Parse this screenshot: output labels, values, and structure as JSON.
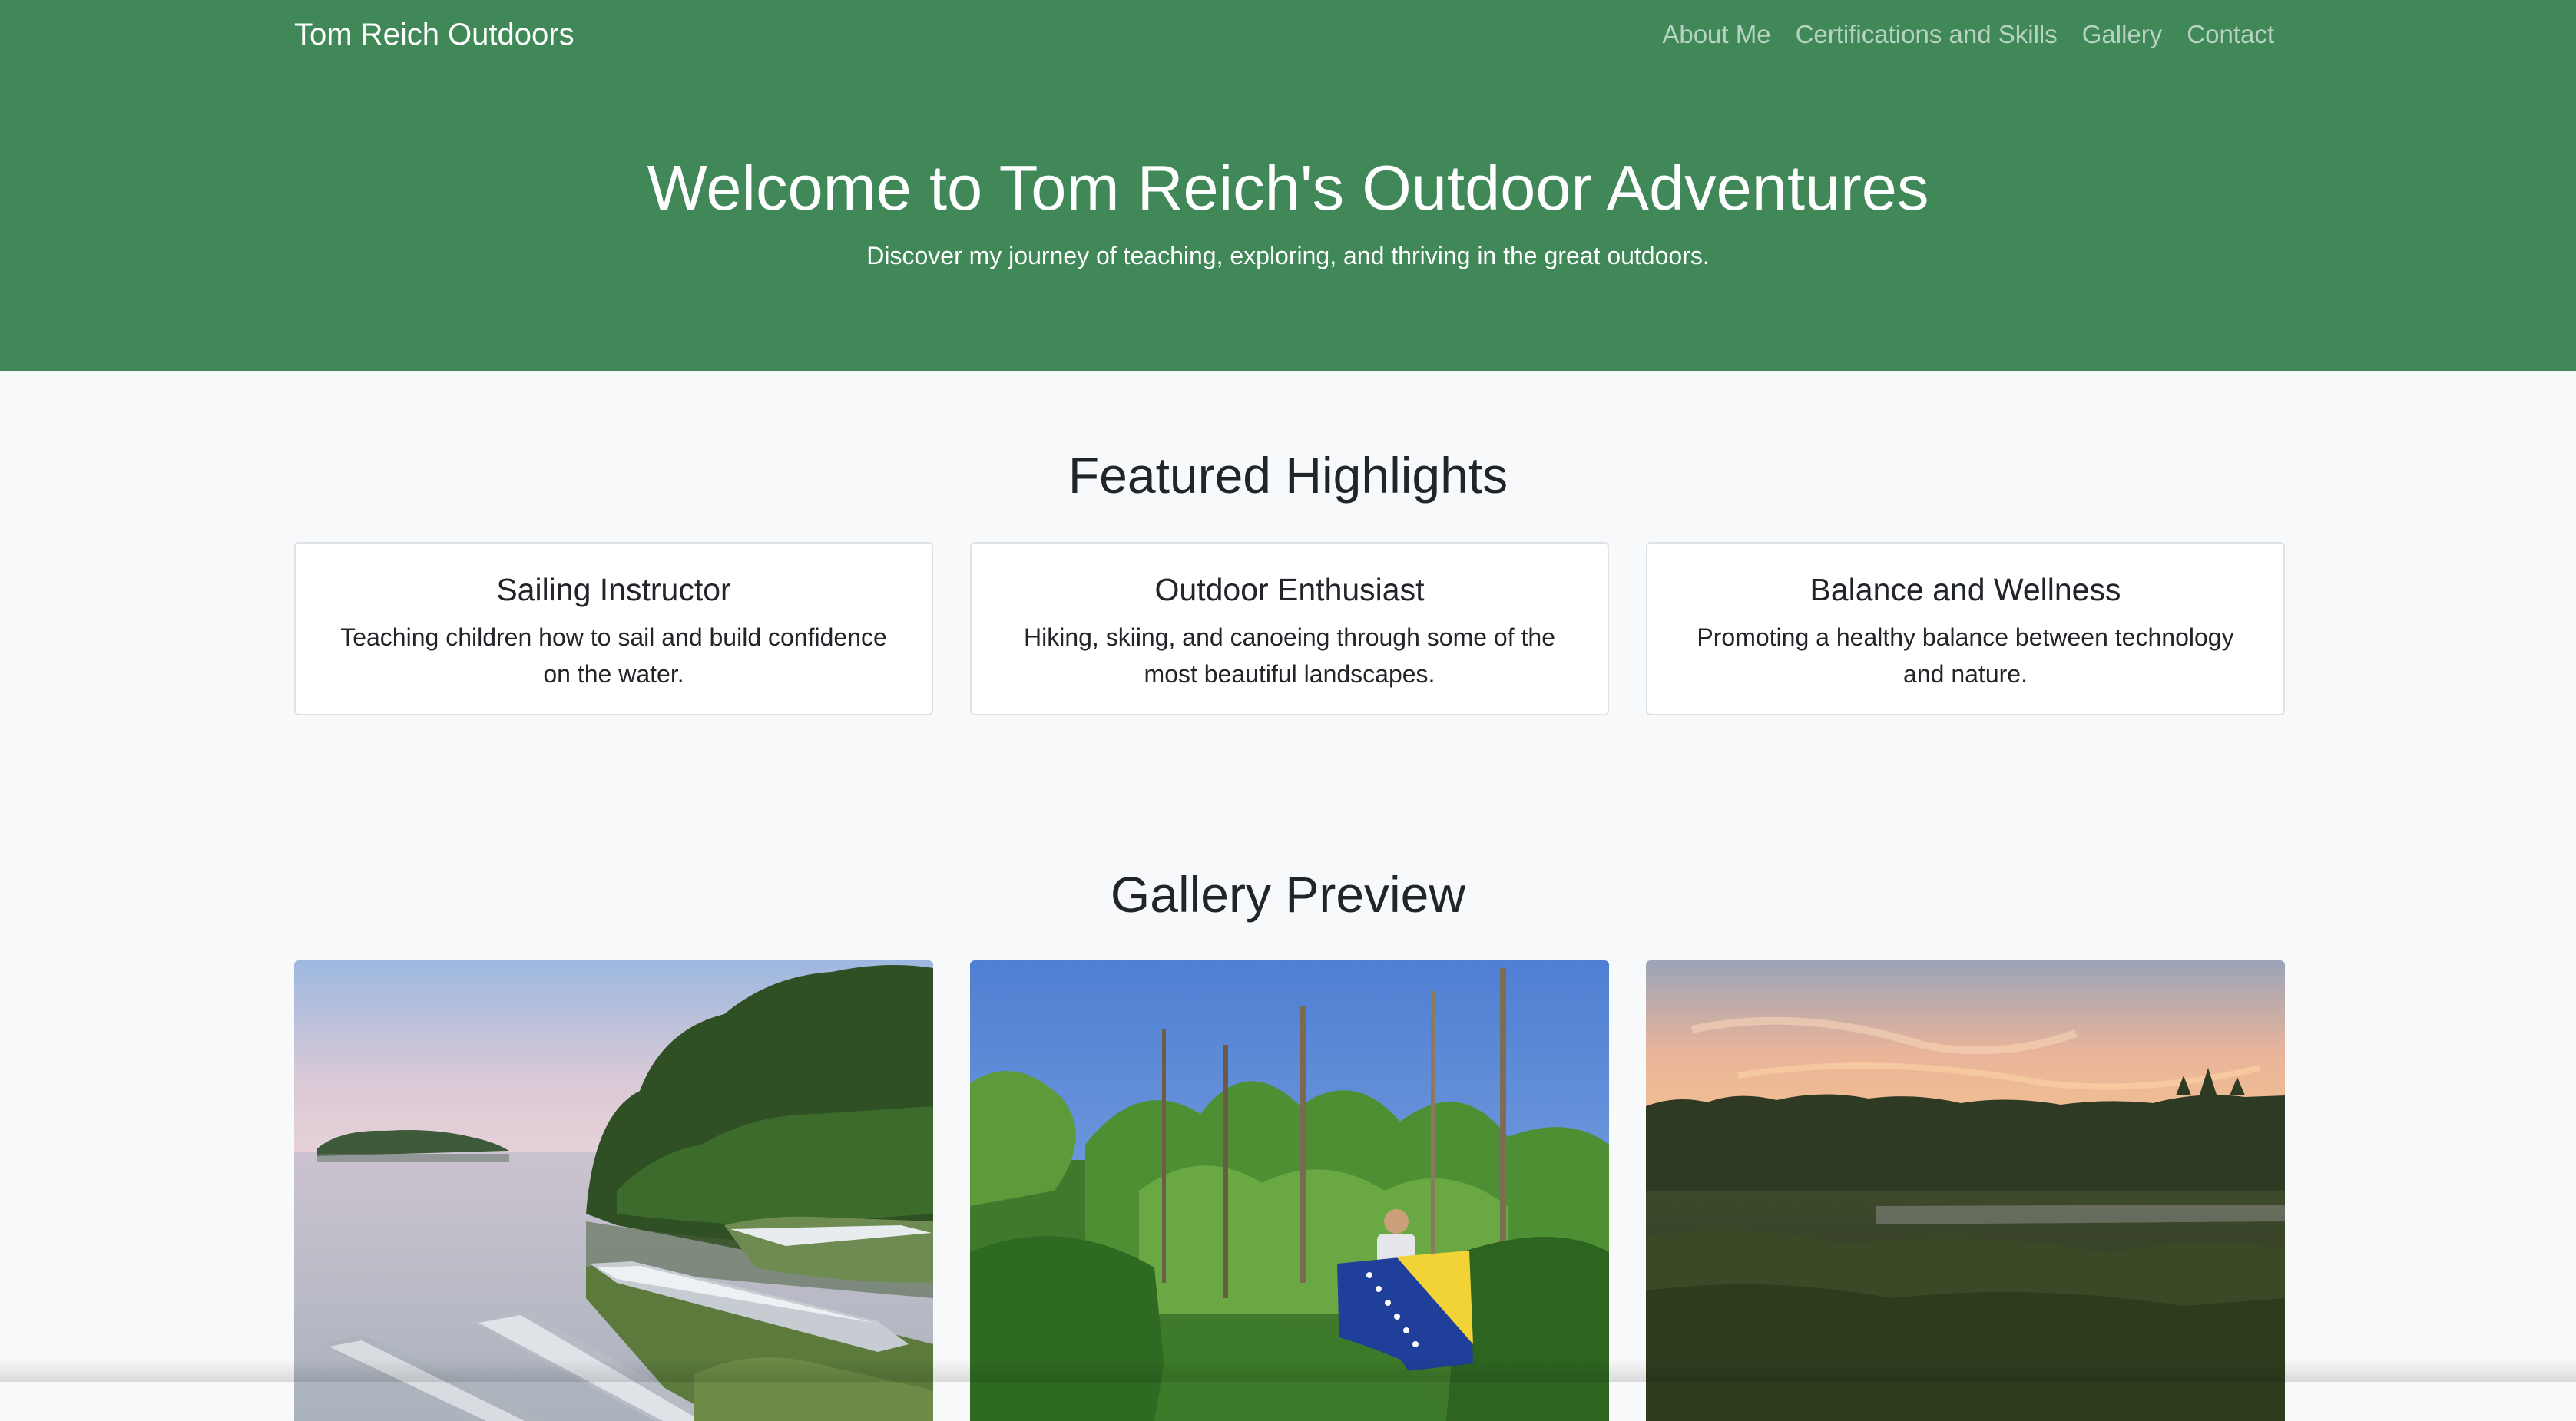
{
  "navbar": {
    "brand": "Tom Reich Outdoors",
    "links": [
      "About Me",
      "Certifications and Skills",
      "Gallery",
      "Contact"
    ]
  },
  "hero": {
    "title": "Welcome to Tom Reich's Outdoor Adventures",
    "subtitle": "Discover my journey of teaching, exploring, and thriving in the great outdoors."
  },
  "highlights": {
    "heading": "Featured Highlights",
    "cards": [
      {
        "title": "Sailing Instructor",
        "text": "Teaching children how to sail and build confidence on the water."
      },
      {
        "title": "Outdoor Enthusiast",
        "text": "Hiking, skiing, and canoeing through some of the most beautiful landscapes."
      },
      {
        "title": "Balance and Wellness",
        "text": "Promoting a healthy balance between technology and nature."
      }
    ]
  },
  "gallery": {
    "heading": "Gallery Preview"
  },
  "colors": {
    "hero_green": "#418859",
    "page_background": "#f8f9fa"
  }
}
